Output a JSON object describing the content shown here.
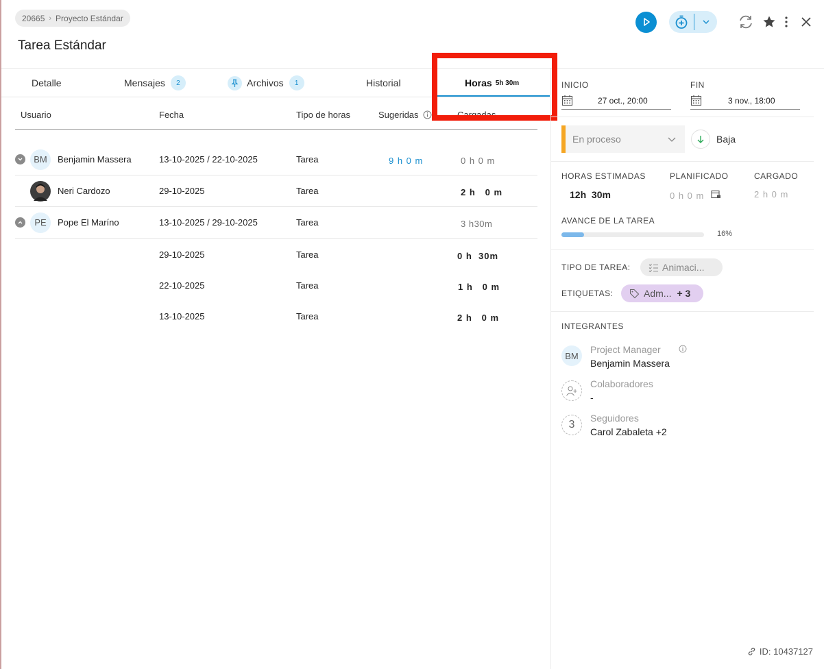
{
  "breadcrumb": {
    "project_id": "20665",
    "project_name": "Proyecto Estándar"
  },
  "title": "Tarea Estándar",
  "tabs": [
    {
      "label": "Detalle"
    },
    {
      "label": "Mensajes",
      "badge": "2"
    },
    {
      "label": "Archivos",
      "badge": "1"
    },
    {
      "label": "Historial"
    },
    {
      "label": "Horas",
      "extra": "5h 30m",
      "active": true
    }
  ],
  "table": {
    "headers": {
      "usuario": "Usuario",
      "fecha": "Fecha",
      "tipo": "Tipo de horas",
      "sugeridas": "Sugeridas",
      "cargadas": "Cargadas"
    },
    "rows": [
      {
        "initials": "BM",
        "user": "Benjamin Massera",
        "fecha": "13-10-2025 / 22-10-2025",
        "tipo": "Tarea",
        "sugeridas": "9 h 0 m",
        "cargadas": "0 h 0 m"
      },
      {
        "user": "Neri Cardozo",
        "fecha": "29-10-2025",
        "tipo": "Tarea",
        "cargadas": "2 h   0 m"
      },
      {
        "initials": "PE",
        "user": "Pope El Maríno",
        "fecha": "13-10-2025 / 29-10-2025",
        "tipo": "Tarea",
        "cargadas": "3 h30m"
      },
      {
        "fecha": "29-10-2025",
        "tipo": "Tarea",
        "cargadas": "0 h  30m"
      },
      {
        "fecha": "22-10-2025",
        "tipo": "Tarea",
        "cargadas": "1 h   0 m"
      },
      {
        "fecha": "13-10-2025",
        "tipo": "Tarea",
        "cargadas": "2 h   0 m"
      }
    ]
  },
  "panel": {
    "inicio_label": "INICIO",
    "inicio_value": "27 oct., 20:00",
    "fin_label": "FIN",
    "fin_value": "3 nov., 18:00",
    "status": "En proceso",
    "priority": "Baja",
    "horas_estimadas_label": "HORAS ESTIMADAS",
    "horas_estimadas_value": "12h  30m",
    "planificado_label": "PLANIFICADO",
    "planificado_value": "0 h 0 m",
    "cargado_label": "CARGADO",
    "cargado_value": "2 h 0 m",
    "avance_label": "AVANCE DE LA TAREA",
    "avance_percent": 16,
    "avance_text": "16%",
    "tipo_label": "TIPO DE TAREA:",
    "tipo_value": "Animaci...",
    "etiquetas_label": "ETIQUETAS:",
    "etiquetas_value": "Adm...",
    "etiquetas_more": "+ 3",
    "integrantes_label": "INTEGRANTES",
    "pm_label": "Project Manager",
    "pm_initials": "BM",
    "pm_name": "Benjamin Massera",
    "colab_label": "Colaboradores",
    "colab_value": "-",
    "seguidores_label": "Seguidores",
    "seguidores_count": "3",
    "seguidores_value": "Carol Zabaleta +2"
  },
  "footer": {
    "id_text": "ID: 10437127"
  },
  "colors": {
    "accent": "#1a8fcf",
    "status": "#f5a623",
    "highlight": "#f21d0a",
    "tag": "#e2cff0"
  }
}
